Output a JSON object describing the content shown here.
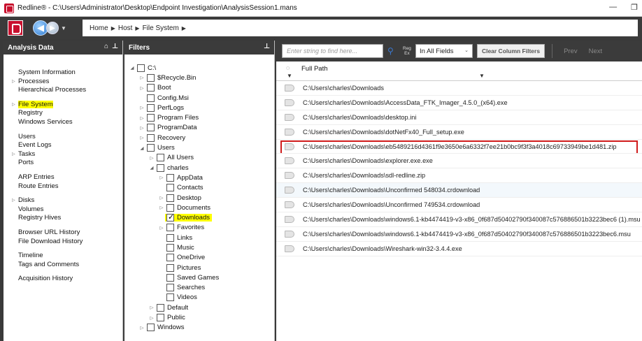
{
  "window": {
    "title": "Redline® - C:\\Users\\Administrator\\Desktop\\Endpoint Investigation\\AnalysisSession1.mans",
    "minimize": "—",
    "restore": "❐"
  },
  "breadcrumb": [
    "Home",
    "Host",
    "File System"
  ],
  "analysis_panel": {
    "title": "Analysis Data",
    "groups": [
      [
        {
          "label": "System Information",
          "arrow": false
        },
        {
          "label": "Processes",
          "arrow": true
        },
        {
          "label": "Hierarchical Processes",
          "arrow": false
        }
      ],
      [
        {
          "label": "File System",
          "arrow": true,
          "highlight": true
        },
        {
          "label": "Registry",
          "arrow": false
        },
        {
          "label": "Windows Services",
          "arrow": false
        }
      ],
      [
        {
          "label": "Users",
          "arrow": false
        },
        {
          "label": "Event Logs",
          "arrow": false
        },
        {
          "label": "Tasks",
          "arrow": true
        },
        {
          "label": "Ports",
          "arrow": false
        }
      ],
      [
        {
          "label": "ARP Entries",
          "arrow": false
        },
        {
          "label": "Route Entries",
          "arrow": false
        }
      ],
      [
        {
          "label": "Disks",
          "arrow": true
        },
        {
          "label": "Volumes",
          "arrow": false
        },
        {
          "label": "Registry Hives",
          "arrow": false
        }
      ],
      [
        {
          "label": "Browser URL History",
          "arrow": false
        },
        {
          "label": "File Download History",
          "arrow": false
        }
      ],
      [
        {
          "label": "Timeline",
          "arrow": false
        },
        {
          "label": "Tags and Comments",
          "arrow": false
        }
      ],
      [
        {
          "label": "Acquisition History",
          "arrow": false
        }
      ]
    ]
  },
  "filters_panel": {
    "title": "Filters",
    "tree": [
      {
        "label": "C:\\",
        "depth": 0,
        "toggle": "expanded",
        "checked": false
      },
      {
        "label": "$Recycle.Bin",
        "depth": 1,
        "toggle": "collapsed",
        "checked": false
      },
      {
        "label": "Boot",
        "depth": 1,
        "toggle": "collapsed",
        "checked": false
      },
      {
        "label": "Config.Msi",
        "depth": 1,
        "toggle": "none",
        "checked": false
      },
      {
        "label": "PerfLogs",
        "depth": 1,
        "toggle": "collapsed",
        "checked": false
      },
      {
        "label": "Program Files",
        "depth": 1,
        "toggle": "collapsed",
        "checked": false
      },
      {
        "label": "ProgramData",
        "depth": 1,
        "toggle": "collapsed",
        "checked": false
      },
      {
        "label": "Recovery",
        "depth": 1,
        "toggle": "collapsed",
        "checked": false
      },
      {
        "label": "Users",
        "depth": 1,
        "toggle": "expanded",
        "checked": false
      },
      {
        "label": "All Users",
        "depth": 2,
        "toggle": "collapsed",
        "checked": false
      },
      {
        "label": "charles",
        "depth": 2,
        "toggle": "expanded",
        "checked": false
      },
      {
        "label": "AppData",
        "depth": 3,
        "toggle": "collapsed",
        "checked": false
      },
      {
        "label": "Contacts",
        "depth": 3,
        "toggle": "none",
        "checked": false
      },
      {
        "label": "Desktop",
        "depth": 3,
        "toggle": "collapsed",
        "checked": false
      },
      {
        "label": "Documents",
        "depth": 3,
        "toggle": "collapsed",
        "checked": false
      },
      {
        "label": "Downloads",
        "depth": 3,
        "toggle": "none",
        "checked": true,
        "highlight": true
      },
      {
        "label": "Favorites",
        "depth": 3,
        "toggle": "collapsed",
        "checked": false
      },
      {
        "label": "Links",
        "depth": 3,
        "toggle": "none",
        "checked": false
      },
      {
        "label": "Music",
        "depth": 3,
        "toggle": "none",
        "checked": false
      },
      {
        "label": "OneDrive",
        "depth": 3,
        "toggle": "none",
        "checked": false
      },
      {
        "label": "Pictures",
        "depth": 3,
        "toggle": "none",
        "checked": false
      },
      {
        "label": "Saved Games",
        "depth": 3,
        "toggle": "none",
        "checked": false
      },
      {
        "label": "Searches",
        "depth": 3,
        "toggle": "none",
        "checked": false
      },
      {
        "label": "Videos",
        "depth": 3,
        "toggle": "none",
        "checked": false
      },
      {
        "label": "Default",
        "depth": 2,
        "toggle": "collapsed",
        "checked": false
      },
      {
        "label": "Public",
        "depth": 2,
        "toggle": "collapsed",
        "checked": false
      },
      {
        "label": "Windows",
        "depth": 1,
        "toggle": "collapsed",
        "checked": false
      }
    ]
  },
  "results": {
    "search_placeholder": "Enter string to find here...",
    "reg_label_1": "Reg",
    "reg_label_2": "Ex",
    "field_select": "In All Fields",
    "clear_button": "Clear Column Filters",
    "prev": "Prev",
    "next": "Next",
    "column_header": "Full Path",
    "rows": [
      {
        "path": "C:\\Users\\charles\\Downloads",
        "boxed": false
      },
      {
        "path": "C:\\Users\\charles\\Downloads\\AccessData_FTK_Imager_4.5.0_(x64).exe",
        "boxed": false
      },
      {
        "path": "C:\\Users\\charles\\Downloads\\desktop.ini",
        "boxed": false
      },
      {
        "path": "C:\\Users\\charles\\Downloads\\dotNetFx40_Full_setup.exe",
        "boxed": false
      },
      {
        "path": "C:\\Users\\charles\\Downloads\\eb5489216d4361f9e3650e6a6332f7ee21b0bc9f3f3a4018c69733949be1d481.zip",
        "boxed": true
      },
      {
        "path": "C:\\Users\\charles\\Downloads\\explorer.exe.exe",
        "boxed": false
      },
      {
        "path": "C:\\Users\\charles\\Downloads\\sdl-redline.zip",
        "boxed": false
      },
      {
        "path": "C:\\Users\\charles\\Downloads\\Unconfirmed 548034.crdownload",
        "boxed": false,
        "alt": true
      },
      {
        "path": "C:\\Users\\charles\\Downloads\\Unconfirmed 749534.crdownload",
        "boxed": false
      },
      {
        "path": "C:\\Users\\charles\\Downloads\\windows6.1-kb4474419-v3-x86_0f687d50402790f340087c576886501b3223bec6 (1).msu",
        "boxed": false
      },
      {
        "path": "C:\\Users\\charles\\Downloads\\windows6.1-kb4474419-v3-x86_0f687d50402790f340087c576886501b3223bec6.msu",
        "boxed": false
      },
      {
        "path": "C:\\Users\\charles\\Downloads\\Wireshark-win32-3.4.4.exe",
        "boxed": false
      }
    ]
  }
}
